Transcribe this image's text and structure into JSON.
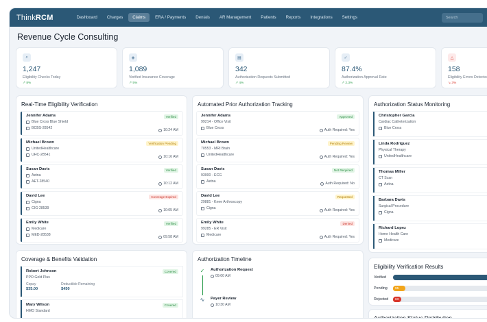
{
  "header": {
    "brand_light": "Think",
    "brand_bold": "RCM",
    "nav": [
      "Dashboard",
      "Charges",
      "Claims",
      "ERA / Payments",
      "Denials",
      "AR Management",
      "Patients",
      "Reports",
      "Integrations",
      "Settings"
    ],
    "active_nav": "Claims",
    "search_placeholder": "Search"
  },
  "page": {
    "title": "Revenue Cycle Consulting"
  },
  "stats": [
    {
      "icon": "search-icon",
      "value": "1,247",
      "label": "Eligibility Checks Today",
      "delta": "↗ 8%",
      "trend": "up"
    },
    {
      "icon": "shield-icon",
      "value": "1,089",
      "label": "Verified Insurance Coverage",
      "delta": "↗ 5%",
      "trend": "up"
    },
    {
      "icon": "document-icon",
      "value": "342",
      "label": "Authorization Requests Submitted",
      "delta": "↗ 4%",
      "trend": "up"
    },
    {
      "icon": "check-circle-icon",
      "value": "87.4%",
      "label": "Authorization Approval Rate",
      "delta": "↗ 2.3%",
      "trend": "up"
    },
    {
      "icon": "alert-icon",
      "value": "158",
      "label": "Eligibility Errors Detected",
      "delta": "↘ 3%",
      "trend": "down"
    }
  ],
  "eligibility": {
    "title": "Real-Time Eligibility Verification",
    "rows": [
      {
        "name": "Jennifer Adams",
        "payer": "Blue Cross Blue Shield",
        "id": "BCBS-28542",
        "status": "Verified",
        "tone": "green",
        "time": "10:24 AM"
      },
      {
        "name": "Michael Brown",
        "payer": "UnitedHealthcare",
        "id": "UHC-28541",
        "status": "Verification Pending",
        "tone": "yellow",
        "time": "10:16 AM"
      },
      {
        "name": "Susan Davis",
        "payer": "Aetna",
        "id": "AET-28540",
        "status": "Verified",
        "tone": "green",
        "time": "10:12 AM"
      },
      {
        "name": "David Lee",
        "payer": "Cigna",
        "id": "CIG-28539",
        "status": "Coverage Expired",
        "tone": "red",
        "time": "10:05 AM"
      },
      {
        "name": "Emily White",
        "payer": "Medicare",
        "id": "MED-28538",
        "status": "Verified",
        "tone": "green",
        "time": "09:58 AM"
      }
    ]
  },
  "prior_auth": {
    "title": "Automated Prior Authorization Tracking",
    "rows": [
      {
        "name": "Jennifer Adams",
        "proc": "99214 - Office Visit",
        "payer": "Blue Cross",
        "status": "Approved",
        "tone": "green",
        "auth": "Auth Required: Yes"
      },
      {
        "name": "Michael Brown",
        "proc": "70553 - MRI Brain",
        "payer": "UnitedHealthcare",
        "status": "Pending Review",
        "tone": "yellow",
        "auth": "Auth Required: Yes"
      },
      {
        "name": "Susan Davis",
        "proc": "93000 - ECG",
        "payer": "Aetna",
        "status": "Not Required",
        "tone": "green",
        "auth": "Auth Required: No"
      },
      {
        "name": "David Lee",
        "proc": "29881 - Knee Arthroscopy",
        "payer": "Cigna",
        "status": "Requested",
        "tone": "yellow",
        "auth": "Auth Required: Yes"
      },
      {
        "name": "Emily White",
        "proc": "99285 - ER Visit",
        "payer": "Medicare",
        "status": "Denied",
        "tone": "red",
        "auth": "Auth Required: Yes"
      }
    ]
  },
  "auth_status": {
    "title": "Authorization Status Monitoring",
    "rows": [
      {
        "name": "Christopher Garcia",
        "proc": "Cardiac Catheterization",
        "payer": "Blue Cross"
      },
      {
        "name": "Linda Rodriguez",
        "proc": "Physical Therapy",
        "payer": "UnitedHealthcare"
      },
      {
        "name": "Thomas Miller",
        "proc": "CT Scan",
        "payer": "Aetna"
      },
      {
        "name": "Barbara Davis",
        "proc": "Surgical Procedure",
        "payer": "Cigna"
      },
      {
        "name": "Richard Lopez",
        "proc": "Home Health Care",
        "payer": "Medicare"
      }
    ]
  },
  "coverage": {
    "title": "Coverage & Benefits Validation",
    "rows": [
      {
        "name": "Robert Johnson",
        "plan": "PPO Gold Plus",
        "status": "Covered",
        "copay_label": "Copay",
        "copay": "$35.00",
        "ded_label": "Deductible Remaining",
        "ded": "$450"
      },
      {
        "name": "Mary Wilson",
        "plan": "HMO Standard",
        "status": "Covered"
      }
    ]
  },
  "timeline": {
    "title": "Authorization Timeline",
    "items": [
      {
        "title": "Authorization Request",
        "time": "09:00 AM",
        "icon": "check-circle-icon"
      },
      {
        "title": "Payer Review",
        "time": "10:30 AM",
        "icon": "activity-icon"
      }
    ]
  },
  "results": {
    "title": "Eligibility Verification Results",
    "rows": [
      {
        "label": "Verified",
        "value": "",
        "fraction": 1.0,
        "color": "#2b5876"
      },
      {
        "label": "Pending",
        "value": "95",
        "fraction": 0.12,
        "color": "#f2a51a"
      },
      {
        "label": "Rejected",
        "value": "63",
        "fraction": 0.08,
        "color": "#d9362b"
      }
    ]
  },
  "distribution": {
    "title": "Authorization Status Distribution"
  }
}
